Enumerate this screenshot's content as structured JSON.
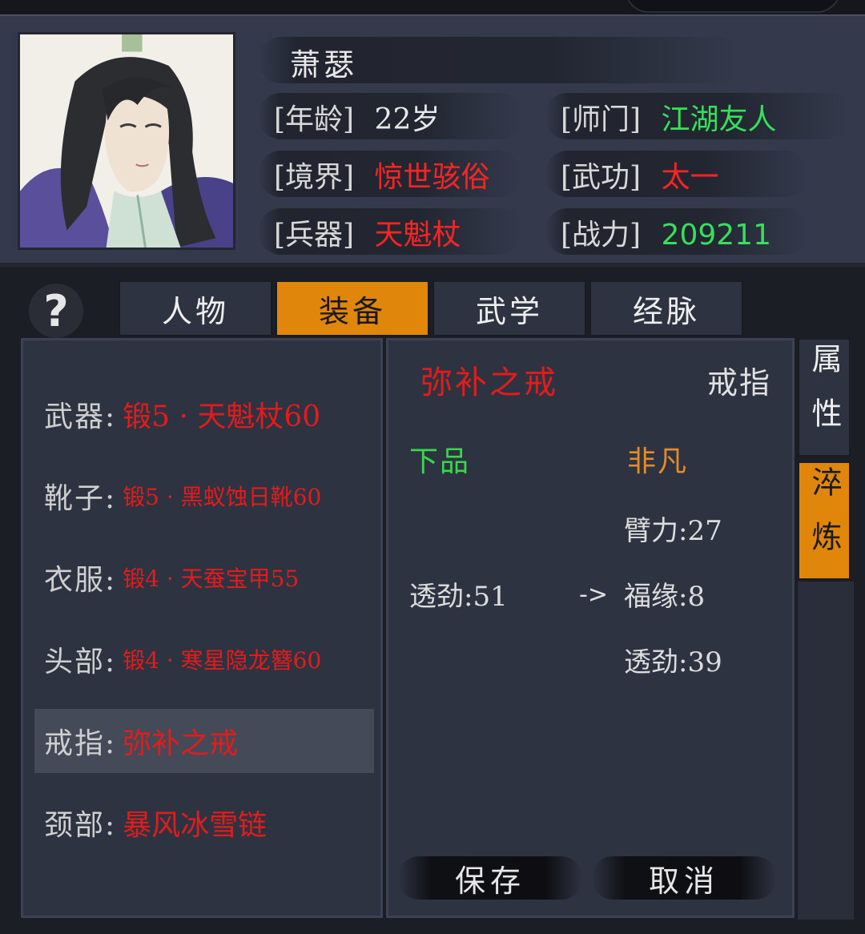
{
  "hero": {
    "name": "萧瑟",
    "stats": [
      {
        "key": "[年龄]",
        "value": "22岁"
      },
      {
        "key": "[师门]",
        "value": "江湖友人"
      },
      {
        "key": "[境界]",
        "value": "惊世骇俗"
      },
      {
        "key": "[武功]",
        "value": "太一"
      },
      {
        "key": "[兵器]",
        "value": "天魁杖"
      },
      {
        "key": "[战力]",
        "value": "209211"
      }
    ]
  },
  "help": {
    "label": "?"
  },
  "tabs": [
    {
      "label": "人物",
      "active": false
    },
    {
      "label": "装备",
      "active": true
    },
    {
      "label": "武学",
      "active": false
    },
    {
      "label": "经脉",
      "active": false
    }
  ],
  "equipment": [
    {
      "slot": "武器:",
      "item": "锻5 · 天魁杖60"
    },
    {
      "slot": "靴子:",
      "item": "锻5 · 黑蚁蚀日靴60"
    },
    {
      "slot": "衣服:",
      "item": "锻4 · 天蚕宝甲55"
    },
    {
      "slot": "头部:",
      "item": "锻4 · 寒星隐龙簪60"
    },
    {
      "slot": "戒指:",
      "item": "弥补之戒",
      "selected": true
    },
    {
      "slot": "颈部:",
      "item": "暴风冰雪链"
    }
  ],
  "detail": {
    "item_name": "弥补之戒",
    "item_type": "戒指",
    "grade_before": "下品",
    "grade_after": "非凡",
    "attrs_before": [
      "透劲:51"
    ],
    "arrow": "->",
    "attrs_after": [
      "臂力:27",
      "福缘:8",
      "透劲:39"
    ],
    "save_label": "保存",
    "cancel_label": "取消"
  },
  "side_tabs": [
    {
      "label": "属性",
      "active": false
    },
    {
      "label": "淬炼",
      "active": true
    }
  ],
  "colors": {
    "accent": "#e0860a",
    "red_text": "#e41b1b",
    "green_text": "#35e05a",
    "orange_text": "#e38a2a",
    "panel": "#2e3342"
  }
}
